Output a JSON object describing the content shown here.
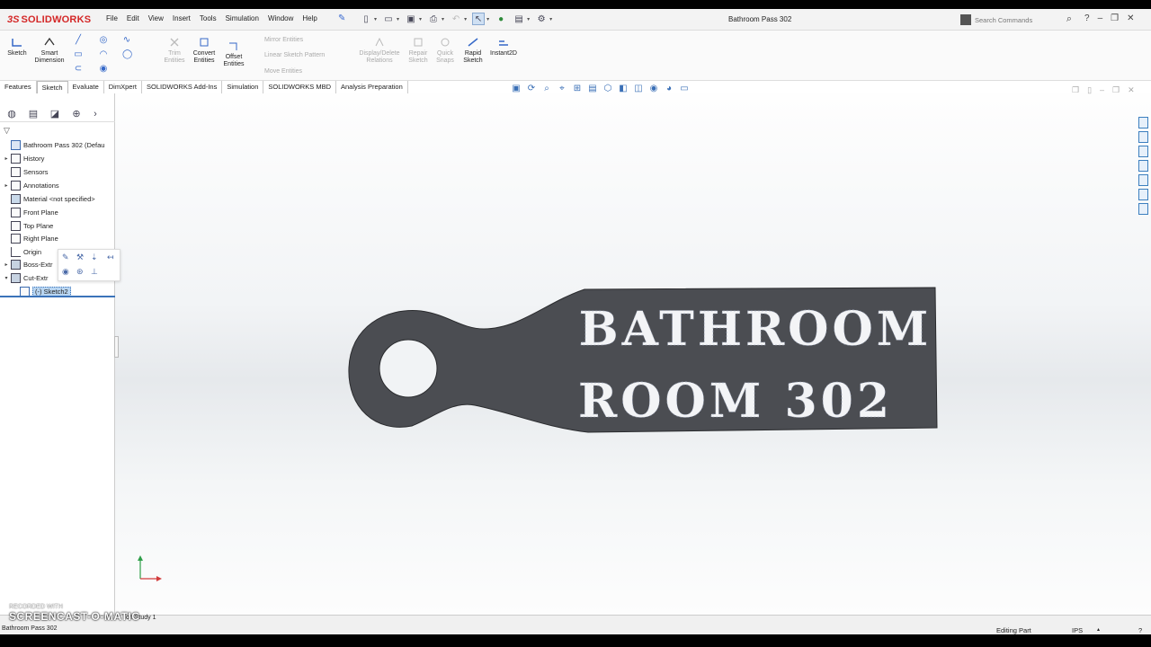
{
  "app": {
    "logo_ds": "3S",
    "logo_text": "SOLIDWORKS",
    "document_title": "Bathroom Pass 302",
    "search_placeholder": "Search Commands"
  },
  "menu": [
    "File",
    "Edit",
    "View",
    "Insert",
    "Tools",
    "Simulation",
    "Window",
    "Help"
  ],
  "ribbon": {
    "sketch": "Sketch",
    "smart_dimension": "Smart Dimension",
    "trim_entities": "Trim Entities",
    "convert_entities": "Convert Entities",
    "offset_entities": "Offset Entities",
    "mirror_entities": "Mirror Entities",
    "linear_sketch_pattern": "Linear Sketch Pattern",
    "move_entities": "Move Entities",
    "display_delete_relations": "Display/Delete Relations",
    "repair_sketch": "Repair Sketch",
    "quick_snaps": "Quick Snaps",
    "rapid_sketch": "Rapid Sketch",
    "instant2d": "Instant2D"
  },
  "command_tabs": [
    "Features",
    "Sketch",
    "Evaluate",
    "DimXpert",
    "SOLIDWORKS Add-Ins",
    "Simulation",
    "SOLIDWORKS MBD",
    "Analysis Preparation"
  ],
  "active_tab": "Sketch",
  "tree": {
    "root": "Bathroom Pass 302  (Defau",
    "items": [
      "History",
      "Sensors",
      "Annotations",
      "Material <not specified>",
      "Front Plane",
      "Top Plane",
      "Right Plane",
      "Origin",
      "Boss-Extr",
      "Cut-Extr",
      "(-) Sketch2"
    ]
  },
  "part": {
    "line1": "BATHROOM",
    "line2": "ROOM 302",
    "body_color": "#4b4d52",
    "text_color": "#f3f4f6"
  },
  "status": {
    "study_tab": "on Study 1",
    "doc_name": "Bathroom Pass 302",
    "editing": "Editing Part",
    "units": "IPS"
  },
  "watermark": {
    "recorded": "RECORDED WITH",
    "brand": "SCREENCAST-O-MATIC"
  }
}
